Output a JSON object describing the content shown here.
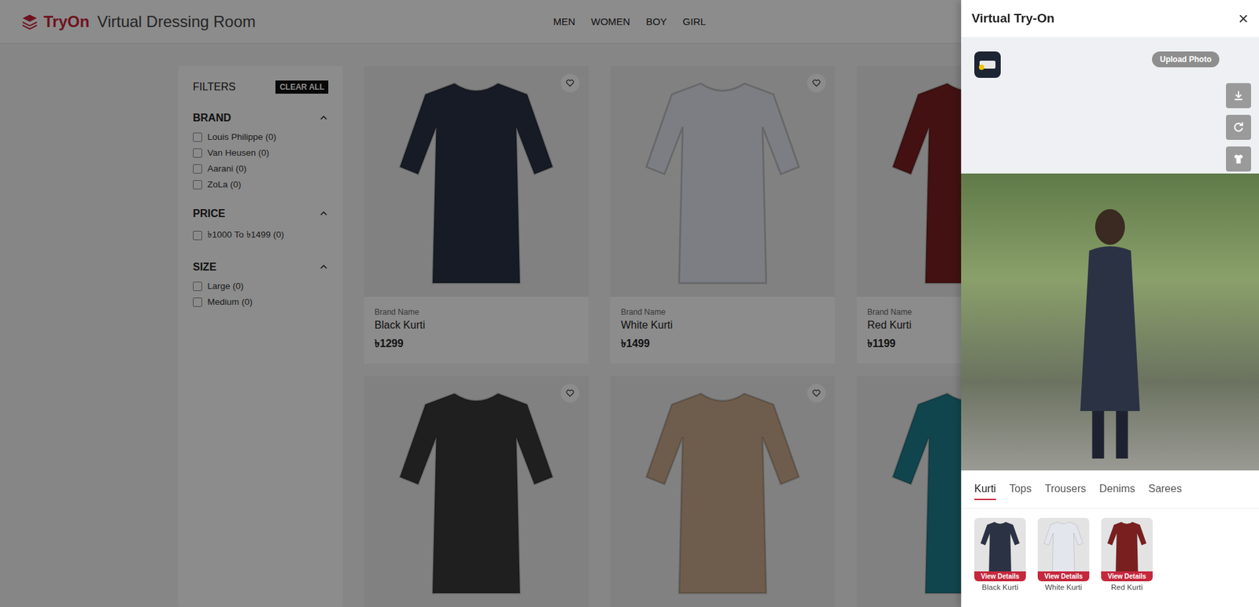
{
  "header": {
    "logo": "TryOn",
    "subtitle": "Virtual Dressing Room",
    "nav": [
      {
        "label": "MEN"
      },
      {
        "label": "WOMEN"
      },
      {
        "label": "BOY"
      },
      {
        "label": "GIRL"
      }
    ]
  },
  "filters": {
    "title": "FILTERS",
    "clear": "CLEAR ALL",
    "groups": [
      {
        "title": "BRAND",
        "expanded": true,
        "options": [
          {
            "label": "Louis Philippe (0)",
            "checked": false
          },
          {
            "label": "Van Heusen (0)",
            "checked": false
          },
          {
            "label": "Aarani (0)",
            "checked": false
          },
          {
            "label": "ZoLa (0)",
            "checked": false
          }
        ]
      },
      {
        "title": "PRICE",
        "expanded": true,
        "options": [
          {
            "label": "৳1000 To ৳1499 (0)",
            "checked": false
          }
        ]
      },
      {
        "title": "SIZE",
        "expanded": true,
        "options": [
          {
            "label": "Large (0)",
            "checked": false
          },
          {
            "label": "Medium (0)",
            "checked": false
          }
        ]
      }
    ]
  },
  "products": [
    {
      "brand": "Brand Name",
      "name": "Black Kurti",
      "price": "৳1299",
      "color": "#2b3244",
      "favorite": false
    },
    {
      "brand": "Brand Name",
      "name": "White Kurti",
      "price": "৳1499",
      "color": "#e4e6ee",
      "favorite": false
    },
    {
      "brand": "Brand Name",
      "name": "Red Kurti",
      "price": "৳1199",
      "color": "#7a1f1f",
      "favorite": false
    },
    {
      "color": "#3a3a3a",
      "favorite": false
    },
    {
      "color": "#c8a98a",
      "favorite": false
    },
    {
      "color": "#1f7f8c",
      "favorite": false
    }
  ],
  "panel": {
    "title": "Virtual Try-On",
    "close": "×",
    "upload": "Upload Photo",
    "tabs": [
      {
        "label": "Kurti",
        "selected": true
      },
      {
        "label": "Tops",
        "selected": false
      },
      {
        "label": "Trousers",
        "selected": false
      },
      {
        "label": "Denims",
        "selected": false
      },
      {
        "label": "Sarees",
        "selected": false
      }
    ],
    "items": [
      {
        "name": "Black Kurti",
        "action": "View Details",
        "color": "#2b3244"
      },
      {
        "name": "White Kurti",
        "action": "View Details",
        "color": "#e4e6ee"
      },
      {
        "name": "Red Kurti",
        "action": "View Details",
        "color": "#7a1f1f"
      }
    ]
  }
}
